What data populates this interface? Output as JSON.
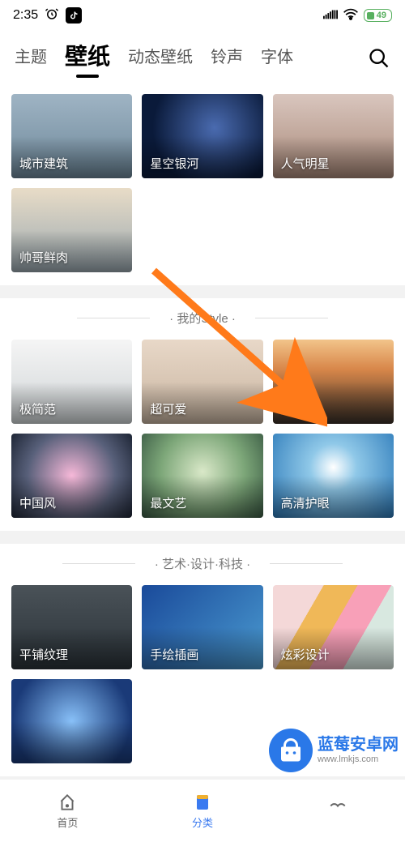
{
  "status": {
    "time": "2:35",
    "battery": "49"
  },
  "tabs": {
    "items": [
      "主题",
      "壁纸",
      "动态壁纸",
      "铃声",
      "字体"
    ],
    "active_index": 1
  },
  "sections": [
    {
      "title": "",
      "cards": [
        {
          "label": "城市建筑",
          "bg": "bg-city"
        },
        {
          "label": "星空银河",
          "bg": "bg-galaxy"
        },
        {
          "label": "人气明星",
          "bg": "bg-celeb"
        },
        {
          "label": "帅哥鲜肉",
          "bg": "bg-guy"
        }
      ]
    },
    {
      "title": "· 我的Style ·",
      "cards": [
        {
          "label": "极简范",
          "bg": "bg-min"
        },
        {
          "label": "超可爱",
          "bg": "bg-cute"
        },
        {
          "label": "文字控",
          "bg": "bg-text"
        },
        {
          "label": "中国风",
          "bg": "bg-cn"
        },
        {
          "label": "最文艺",
          "bg": "bg-arty"
        },
        {
          "label": "高清护眼",
          "bg": "bg-hd"
        }
      ]
    },
    {
      "title": "· 艺术·设计·科技 ·",
      "cards": [
        {
          "label": "平铺纹理",
          "bg": "bg-tile"
        },
        {
          "label": "手绘插画",
          "bg": "bg-draw"
        },
        {
          "label": "炫彩设计",
          "bg": "bg-color"
        },
        {
          "label": "",
          "bg": "bg-blue"
        }
      ]
    }
  ],
  "nav": {
    "items": [
      {
        "label": "首页",
        "icon": "home"
      },
      {
        "label": "分类",
        "icon": "category"
      },
      {
        "label": "",
        "icon": "more"
      }
    ],
    "active_index": 1
  },
  "watermark": {
    "title": "蓝莓安卓网",
    "url": "www.lmkjs.com"
  }
}
